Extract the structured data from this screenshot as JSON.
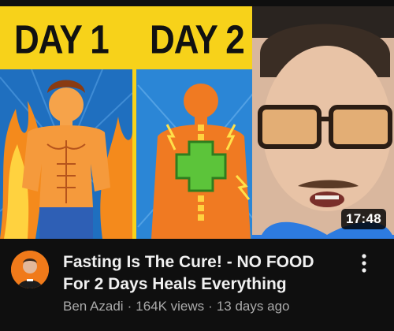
{
  "thumbnail": {
    "day1_label": "DAY 1",
    "day2_label": "DAY 2",
    "duration": "17:48",
    "colors": {
      "banner": "#f7d21a",
      "panel_blue": "#1f77c9",
      "fire": "#f48a1c",
      "cross": "#5cc43a"
    }
  },
  "video": {
    "title": "Fasting Is The Cure! - NO FOOD For 2 Days Heals Everything",
    "channel": "Ben Azadi",
    "views": "164K views",
    "age": "13 days ago",
    "separator": "·"
  },
  "icons": {
    "more": "more-vert-icon",
    "avatar": "channel-avatar"
  }
}
